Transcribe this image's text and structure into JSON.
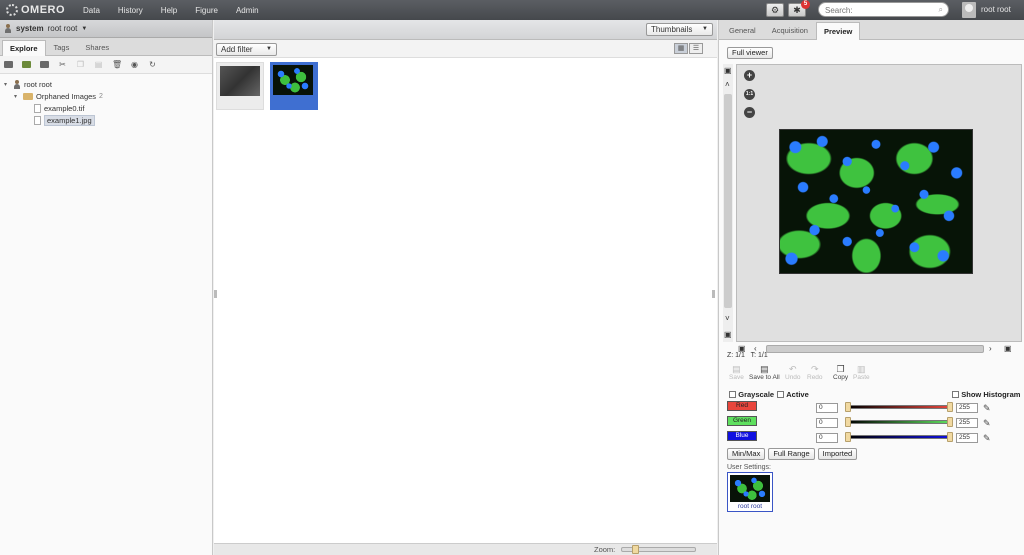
{
  "app": {
    "logo_text": "OMERO"
  },
  "topnav": [
    "Data",
    "History",
    "Help",
    "Figure",
    "Admin"
  ],
  "notifications": {
    "count": "5"
  },
  "search": {
    "placeholder": "Search:"
  },
  "user": {
    "name": "root root"
  },
  "left_panel": {
    "group": "system",
    "user": "root root",
    "tabs": [
      "Explore",
      "Tags",
      "Shares"
    ],
    "tree": {
      "root": "root root",
      "folder": {
        "label": "Orphaned Images",
        "count": "2"
      },
      "files": [
        "example0.tif",
        "example1.jpg"
      ]
    }
  },
  "center_panel": {
    "view_mode": "Thumbnails",
    "filter_label": "Add filter",
    "zoom_label": "Zoom:",
    "zoom_level": 0.15
  },
  "right_panel": {
    "tabs": [
      "General",
      "Acquisition",
      "Preview"
    ],
    "full_viewer": "Full viewer",
    "z_label": "Z: 1/1",
    "t_label": "T: 1/1",
    "toolbar": [
      "Save",
      "Save to All",
      "Undo",
      "Redo",
      "Copy",
      "Paste"
    ],
    "grayscale": "Grayscale",
    "active": "Active",
    "show_histogram": "Show Histogram",
    "channels": [
      {
        "name": "Red",
        "min": "0",
        "max": "255",
        "color": "#e8453c",
        "start": 0.0,
        "end": 1.0
      },
      {
        "name": "Green",
        "min": "0",
        "max": "255",
        "color": "#5fe05f",
        "start": 0.0,
        "end": 1.0
      },
      {
        "name": "Blue",
        "min": "0",
        "max": "255",
        "color": "#1010e0",
        "start": 0.0,
        "end": 1.0
      }
    ],
    "range_buttons": [
      "Min/Max",
      "Full Range",
      "Imported"
    ],
    "user_settings_label": "User Settings:",
    "user_settings_owner": "root root"
  }
}
